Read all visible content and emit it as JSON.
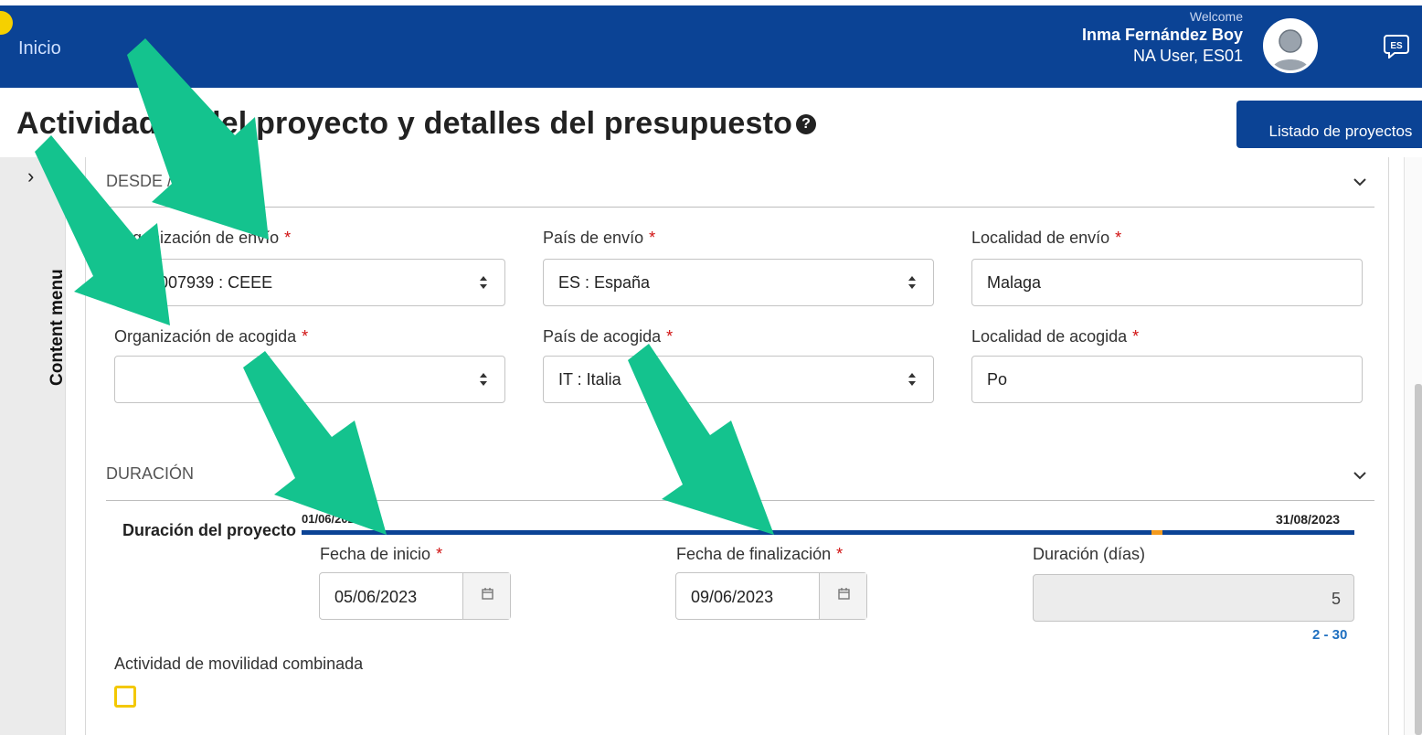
{
  "header": {
    "home_link": "Inicio",
    "welcome": "Welcome",
    "user_name": "Inma Fernández Boy",
    "user_role": "NA User, ES01",
    "language_code": "ES"
  },
  "page": {
    "title": "Actividades del proyecto y detalles del presupuesto",
    "help_glyph": "?",
    "projects_button": "Listado de proyectos"
  },
  "side_panel": {
    "label": "Content menu",
    "toggle_glyph": "›"
  },
  "section_from_to": {
    "heading": "DESDE / HASTA",
    "sending_org_label": "Organización de envío",
    "sending_org_value": "E10007939 : CEEE",
    "sending_country_label": "País de envío",
    "sending_country_value": "ES : España",
    "sending_city_label": "Localidad de envío",
    "sending_city_value": "Malaga",
    "host_org_label": "Organización de acogida",
    "host_org_value": "",
    "host_country_label": "País de acogida",
    "host_country_value": "IT : Italia",
    "host_city_label": "Localidad de acogida",
    "host_city_value": "Po",
    "required_mark": "*"
  },
  "section_duration": {
    "heading": "DURACIÓN",
    "project_duration_label": "Duración del proyecto",
    "timeline_start": "01/06/2023",
    "timeline_end": "31/08/2023",
    "start_label": "Fecha de inicio",
    "start_value": "05/06/2023",
    "end_label": "Fecha de finalización",
    "end_value": "09/06/2023",
    "days_label": "Duración (días)",
    "days_value": "5",
    "days_range": "2 - 30",
    "combined_label": "Actividad de movilidad combinada",
    "combined_checked": false
  },
  "colors": {
    "brand_blue": "#0b4395",
    "annotation_arrow": "#14c38e",
    "required": "#d01010",
    "checkbox_border": "#f3c800",
    "timeline_marker": "#f39a1e"
  },
  "icons": [
    "help-icon",
    "avatar-icon",
    "language-icon",
    "chevron-down-icon",
    "sort-icon",
    "calendar-icon",
    "chevron-right-icon"
  ]
}
